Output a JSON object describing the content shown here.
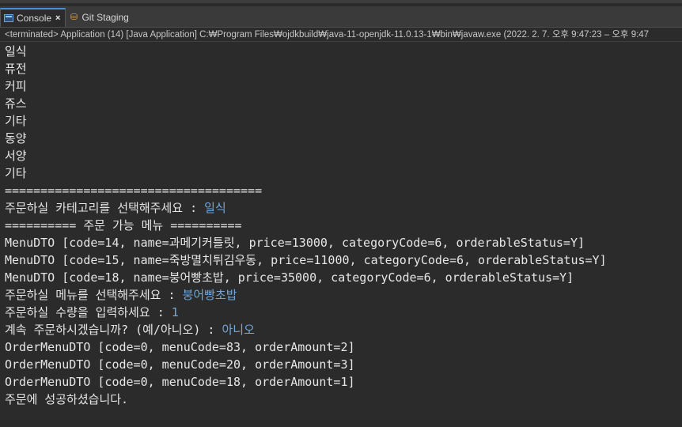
{
  "tabs": [
    {
      "label": "Console",
      "icon": "console-icon",
      "active": true,
      "close": "×"
    },
    {
      "label": "Git Staging",
      "icon": "git-staging-icon",
      "active": false
    }
  ],
  "status": "<terminated> Application (14) [Java Application] C:₩Program Files₩ojdkbuild₩java-11-openjdk-11.0.13-1₩bin₩javaw.exe  (2022. 2. 7. 오후 9:47:23 – 오후 9:47",
  "console": {
    "input_color": "#6fa8dc",
    "lines": [
      {
        "text": "일식"
      },
      {
        "text": "퓨전"
      },
      {
        "text": "커피"
      },
      {
        "text": "쥬스"
      },
      {
        "text": "기타"
      },
      {
        "text": "동양"
      },
      {
        "text": "서양"
      },
      {
        "text": "기타"
      },
      {
        "text": "===================================="
      },
      {
        "text": "주문하실 카테고리를 선택해주세요 : ",
        "input": "일식"
      },
      {
        "text": "========== 주문 가능 메뉴 =========="
      },
      {
        "text": "MenuDTO [code=14, name=과메기커틀릿, price=13000, categoryCode=6, orderableStatus=Y]"
      },
      {
        "text": "MenuDTO [code=15, name=죽방멸치튀김우동, price=11000, categoryCode=6, orderableStatus=Y]"
      },
      {
        "text": "MenuDTO [code=18, name=붕어빵초밥, price=35000, categoryCode=6, orderableStatus=Y]"
      },
      {
        "text": "주문하실 메뉴를 선택해주세요 : ",
        "input": "붕어빵초밥"
      },
      {
        "text": "주문하실 수량을 입력하세요 : ",
        "input": "1"
      },
      {
        "text": "계속 주문하시겠습니까? (예/아니오) : ",
        "input": "아니오"
      },
      {
        "text": "OrderMenuDTO [code=0, menuCode=83, orderAmount=2]"
      },
      {
        "text": "OrderMenuDTO [code=0, menuCode=20, orderAmount=3]"
      },
      {
        "text": "OrderMenuDTO [code=0, menuCode=18, orderAmount=1]"
      },
      {
        "text": "주문에 성공하셨습니다."
      }
    ]
  }
}
